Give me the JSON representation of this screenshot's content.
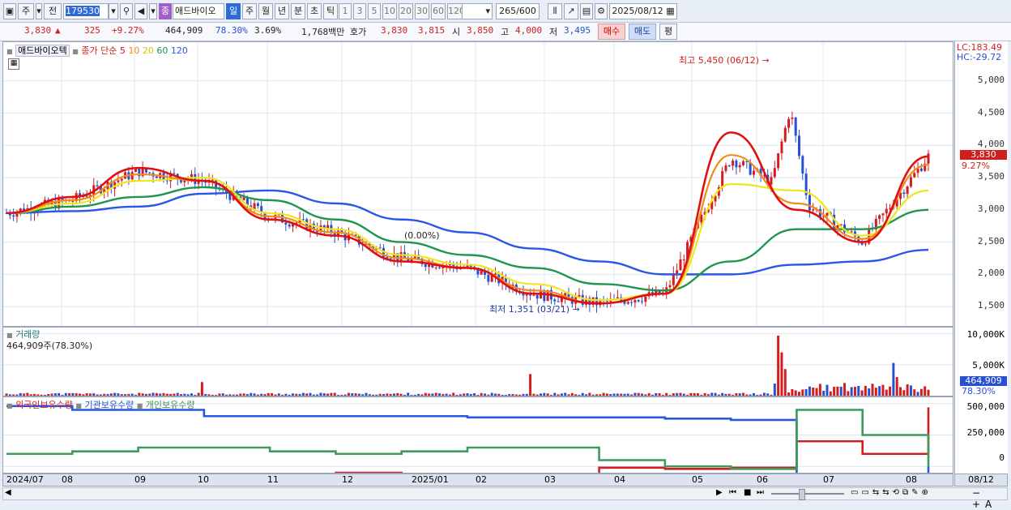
{
  "toolbar": {
    "mode1": "주",
    "mode2": "전",
    "code": "179530",
    "stock_badge": "종",
    "stock_name": "애드바이오",
    "periods": [
      "일",
      "주",
      "월",
      "년",
      "분",
      "초",
      "틱"
    ],
    "active_period": "일",
    "numbers": [
      "1",
      "3",
      "5",
      "10",
      "20",
      "30",
      "60",
      "120"
    ],
    "count": "265",
    "count_max": "/600",
    "date": "2025/08/12"
  },
  "quote": {
    "price": "3,830",
    "arrow": "▲",
    "change": "325",
    "change_pct": "+9.27%",
    "volume": "464,909",
    "volume_pct": "78.30%",
    "turnover": "3.69%",
    "amount": "1,768백만",
    "hoga_label": "호가",
    "ask": "3,830",
    "bid": "3,815",
    "open_label": "시",
    "open": "3,850",
    "high_label": "고",
    "high": "4,000",
    "low_label": "저",
    "low": "3,495",
    "buy_button": "매수",
    "sell_button": "매도",
    "eval_button": "평"
  },
  "price_panel": {
    "name": "애드바이오텍",
    "legend_prefix": "종가 단순",
    "ma_labels": [
      "5",
      "10",
      "20",
      "60",
      "120"
    ],
    "lc": "LC:183.49",
    "hc": "HC:-29.72",
    "current_tag": "3,830",
    "current_pct": "9.27%",
    "max_annotation": "최고 5,450 (06/12)",
    "min_annotation": "최저 1,351 (03/21)",
    "mid_annotation": "(0.00%)"
  },
  "volume_panel": {
    "title": "거래량",
    "subtitle": "464,909주(78.30%)",
    "current_tag": "464,909",
    "current_pct": "78.30%"
  },
  "holding_panel": {
    "legend": [
      "외국인보유수량",
      "기관보유수량",
      "개인보유수량"
    ]
  },
  "x_axis": {
    "labels": [
      "2024/07",
      "08",
      "09",
      "10",
      "11",
      "12",
      "2025/01",
      "02",
      "03",
      "04",
      "05",
      "06",
      "07",
      "08"
    ],
    "right_label": "08/12"
  },
  "colors": {
    "ma5": "#e01010",
    "ma10": "#f08c1e",
    "ma20": "#f0e61e",
    "ma60": "#1e9650",
    "ma120": "#2856e6",
    "up": "#d21e1e",
    "down": "#2850d2",
    "foreign": "#d21e1e",
    "institution": "#2858e0",
    "individual": "#3c9a5a"
  },
  "chart_data": [
    {
      "type": "line",
      "title": "애드바이오텍",
      "x": [
        "2024/07",
        "08",
        "09",
        "10",
        "11",
        "12",
        "2025/01",
        "02",
        "03",
        "04",
        "05",
        "06",
        "07",
        "08"
      ],
      "ylim": [
        1200,
        5600
      ],
      "yticks": [
        1500,
        2000,
        2500,
        3000,
        3500,
        4000,
        4500,
        5000
      ],
      "price": [
        2950,
        3150,
        3600,
        3450,
        2900,
        2650,
        2250,
        2100,
        1700,
        1550,
        1700,
        3800,
        3200,
        2500,
        3830
      ],
      "series": [
        {
          "name": "5",
          "values": [
            2950,
            3200,
            3650,
            3450,
            2850,
            2600,
            2200,
            2100,
            1700,
            1550,
            1700,
            4200,
            3000,
            2500,
            3830
          ]
        },
        {
          "name": "10",
          "values": [
            2950,
            3150,
            3550,
            3450,
            2900,
            2650,
            2250,
            2100,
            1750,
            1550,
            1700,
            3850,
            3100,
            2550,
            3700
          ]
        },
        {
          "name": "20",
          "values": [
            2950,
            3100,
            3450,
            3500,
            2950,
            2700,
            2300,
            2150,
            1850,
            1600,
            1700,
            3400,
            3300,
            2600,
            3300
          ]
        },
        {
          "name": "60",
          "values": [
            2950,
            3050,
            3200,
            3350,
            3150,
            2850,
            2500,
            2300,
            2100,
            1850,
            1750,
            2200,
            2700,
            2700,
            3000
          ]
        },
        {
          "name": "120",
          "values": [
            2950,
            2980,
            3050,
            3250,
            3300,
            3100,
            2850,
            2650,
            2400,
            2200,
            2000,
            2000,
            2150,
            2200,
            2380
          ]
        }
      ],
      "annotations": {
        "max": "최고 5,450 (06/12)",
        "min": "최저 1,351 (03/21)"
      }
    },
    {
      "type": "bar",
      "title": "거래량",
      "x": [
        "2024/07",
        "08",
        "09",
        "10",
        "11",
        "12",
        "2025/01",
        "02",
        "03",
        "04",
        "05",
        "06",
        "07",
        "08"
      ],
      "ylim": [
        0,
        11000
      ],
      "yticks_labels": [
        "5,000K",
        "10,000K"
      ],
      "yticks": [
        5000,
        10000
      ],
      "peaks": [
        {
          "date": "09",
          "value": 2200
        },
        {
          "date": "02",
          "value": 3500
        },
        {
          "date": "06/12",
          "value": 9700
        },
        {
          "date": "08",
          "value": 5300
        }
      ],
      "last": 465
    },
    {
      "type": "line",
      "title": "외국인보유수량 / 기관보유수량 / 개인보유수량",
      "x": [
        "2024/07",
        "08",
        "09",
        "10",
        "11",
        "12",
        "2025/01",
        "02",
        "03",
        "04",
        "05",
        "06",
        "07",
        "08"
      ],
      "ylim": [
        -50000,
        550000
      ],
      "yticks": [
        0,
        250000,
        500000
      ],
      "yticks_labels": [
        "0",
        "250,000",
        "500,000"
      ],
      "series": [
        {
          "name": "외국인보유수량",
          "values": [
            -80000,
            -90000,
            -80000,
            -90000,
            -80000,
            -50000,
            -60000,
            -70000,
            -80000,
            -10000,
            -20000,
            -10000,
            200000,
            100000,
            470000
          ]
        },
        {
          "name": "기관보유수량",
          "values": [
            480000,
            450000,
            450000,
            400000,
            400000,
            400000,
            400000,
            390000,
            390000,
            390000,
            380000,
            370000,
            -100000,
            -100000,
            0
          ]
        },
        {
          "name": "개인보유수량",
          "values": [
            100000,
            120000,
            150000,
            150000,
            120000,
            100000,
            120000,
            150000,
            150000,
            50000,
            0,
            -20000,
            450000,
            250000,
            0
          ]
        }
      ]
    }
  ]
}
